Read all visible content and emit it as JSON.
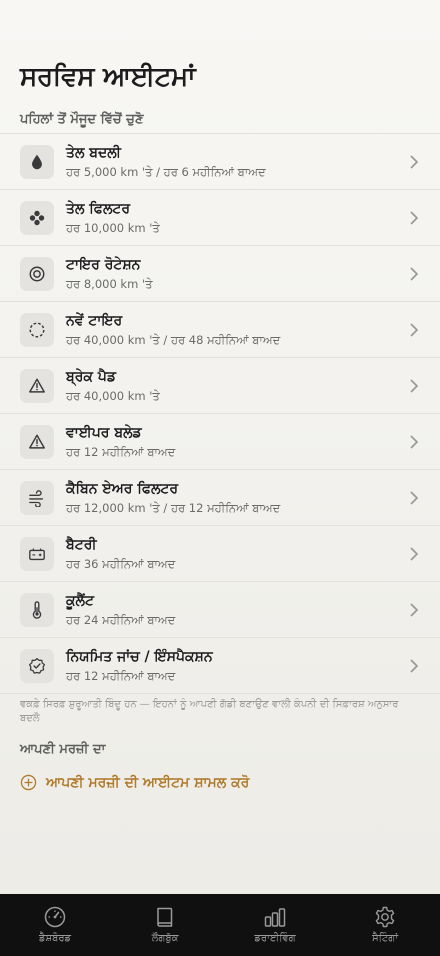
{
  "page_title": "ਸਰਵਿਸ ਆਈਟਮਾਂ",
  "preset_section_header": "ਪਹਿਲਾਂ ਤੋਂ ਮੌਜੂਦ ਵਿੱਚੋਂ ਚੁਣੋ",
  "service_items": [
    {
      "title": "ਤੇਲ ਬਦਲੀ",
      "subtitle": "ਹਰ 5,000 km 'ਤੇ / ਹਰ 6 ਮਹੀਨਿਆਂ ਬਾਅਦ",
      "icon": "oil-drop-icon"
    },
    {
      "title": "ਤੇਲ ਫਿਲਟਰ",
      "subtitle": "ਹਰ 10,000 km 'ਤੇ",
      "icon": "filter-icon"
    },
    {
      "title": "ਟਾਇਰ ਰੋਟੇਸ਼ਨ",
      "subtitle": "ਹਰ 8,000 km 'ਤੇ",
      "icon": "tire-rotation-icon"
    },
    {
      "title": "ਨਵੇਂ ਟਾਇਰ",
      "subtitle": "ਹਰ 40,000 km 'ਤੇ / ਹਰ 48 ਮਹੀਨਿਆਂ ਬਾਅਦ",
      "icon": "tire-icon"
    },
    {
      "title": "ਬ੍ਰੇਕ ਪੈਡ",
      "subtitle": "ਹਰ 40,000 km 'ਤੇ",
      "icon": "warning-triangle-icon"
    },
    {
      "title": "ਵਾਈਪਰ ਬਲੇਡ",
      "subtitle": "ਹਰ 12 ਮਹੀਨਿਆਂ ਬਾਅਦ",
      "icon": "warning-triangle-icon"
    },
    {
      "title": "ਕੈਬਿਨ ਏਅਰ ਫਿਲਟਰ",
      "subtitle": "ਹਰ 12,000 km 'ਤੇ / ਹਰ 12 ਮਹੀਨਿਆਂ ਬਾਅਦ",
      "icon": "air-flow-icon"
    },
    {
      "title": "ਬੈਟਰੀ",
      "subtitle": "ਹਰ 36 ਮਹੀਨਿਆਂ ਬਾਅਦ",
      "icon": "battery-icon"
    },
    {
      "title": "ਕੂਲੈਂਟ",
      "subtitle": "ਹਰ 24 ਮਹੀਨਿਆਂ ਬਾਅਦ",
      "icon": "thermometer-icon"
    },
    {
      "title": "ਨਿਯਮਿਤ ਜਾਂਚ / ਇੰਸਪੈਕਸ਼ਨ",
      "subtitle": "ਹਰ 12 ਮਹੀਨਿਆਂ ਬਾਅਦ",
      "icon": "check-badge-icon"
    }
  ],
  "footnote": "ਵਕਫ਼ੇ ਸਿਰਫ਼ ਸ਼ੁਰੂਆਤੀ ਬਿੰਦੂ ਹਨ — ਇਹਨਾਂ ਨੂੰ ਆਪਣੀ ਗੱਡੀ ਬਣਾਉਣ ਵਾਲੀ ਕੰਪਨੀ ਦੀ ਸਿਫ਼ਾਰਸ਼ ਅਨੁਸਾਰ ਬਦਲੋ",
  "custom_section_header": "ਆਪਣੀ ਮਰਜ਼ੀ ਦਾ",
  "add_custom_label": "ਆਪਣੀ ਮਰਜ਼ੀ ਦੀ ਆਈਟਮ ਸ਼ਾਮਲ ਕਰੋ",
  "tabs": [
    {
      "label": "ਡੈਸ਼ਬੋਰਡ",
      "icon": "speedometer-icon"
    },
    {
      "label": "ਲੌਗਬੁੱਕ",
      "icon": "book-icon"
    },
    {
      "label": "ਡਰਾਈਵਿੰਗ",
      "icon": "bar-chart-icon"
    },
    {
      "label": "ਸੈਟਿੰਗਾਂ",
      "icon": "gear-icon"
    }
  ],
  "colors": {
    "accent": "#b07a2a",
    "tabbar_bg": "#101010",
    "background": "#f4f3f0"
  }
}
